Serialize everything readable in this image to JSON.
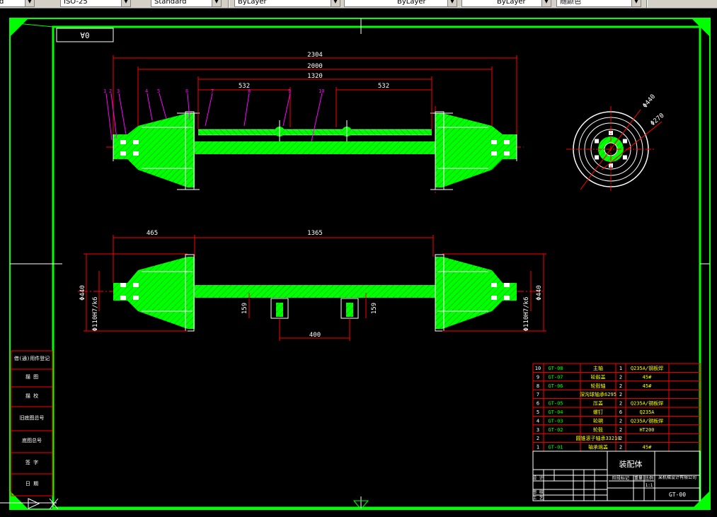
{
  "toolbar": {
    "textstyle": "ISO-25",
    "dimstyle": "Standard",
    "layer": "ByLayer",
    "linetype": "ByLayer",
    "lineweight": "ByLayer",
    "plotstyle": "随颜色"
  },
  "drawing": {
    "corner_code": "0A",
    "top_view": {
      "dims": [
        "2304",
        "2000",
        "1320",
        "532",
        "532"
      ],
      "balloons": [
        "1",
        "2",
        "3",
        "4",
        "5",
        "6",
        "7",
        "8",
        "9",
        "10"
      ]
    },
    "front_view": {
      "dims": [
        "465",
        "1365",
        "400",
        "159",
        "159"
      ],
      "left_dims": [
        "Φ440",
        "Φ110H7/k6"
      ],
      "right_dims": [
        "Φ440",
        "Φ110H7/k6"
      ]
    },
    "hub_view": {
      "dims": [
        "Φ440",
        "Φ270"
      ]
    },
    "side_labels": [
      "借(通)用件登记",
      "描 图",
      "描 校",
      "旧底图总号",
      "底图总号",
      "签 字",
      "日 期"
    ],
    "bom": [
      {
        "no": "10",
        "code": "GT-08",
        "name": "主轴",
        "qty": "1",
        "material": "Q235A/钢板焊"
      },
      {
        "no": "9",
        "code": "GT-07",
        "name": "轮毂盖",
        "qty": "2",
        "material": "45#"
      },
      {
        "no": "8",
        "code": "GT-06",
        "name": "轮毂轴",
        "qty": "2",
        "material": "45#"
      },
      {
        "no": "7",
        "code": "",
        "name": "深沟球轴承6295",
        "qty": "2",
        "material": ""
      },
      {
        "no": "6",
        "code": "GT-05",
        "name": "压盖",
        "qty": "2",
        "material": "Q235A/钢板焊"
      },
      {
        "no": "5",
        "code": "GT-04",
        "name": "螺钉",
        "qty": "6",
        "material": "Q235A"
      },
      {
        "no": "4",
        "code": "GT-03",
        "name": "轮辋",
        "qty": "2",
        "material": "Q235A/钢板焊"
      },
      {
        "no": "3",
        "code": "GT-02",
        "name": "轮毂",
        "qty": "2",
        "material": "HT200"
      },
      {
        "no": "2",
        "code": "",
        "name": "圆锥滚子轴承33210",
        "qty": "2",
        "material": ""
      },
      {
        "no": "1",
        "code": "GT-01",
        "name": "轴承端盖",
        "qty": "2",
        "material": "45#"
      }
    ],
    "title_block": {
      "title": "装配体",
      "company": "某机械设计有限公司",
      "drawing_no": "GT-00",
      "label_design": "设 计",
      "label_check": "审 核",
      "label_process": "工 艺",
      "label_stage": "阶段标记",
      "label_weight": "重量",
      "label_scale": "比例",
      "scale": "1:1"
    }
  }
}
